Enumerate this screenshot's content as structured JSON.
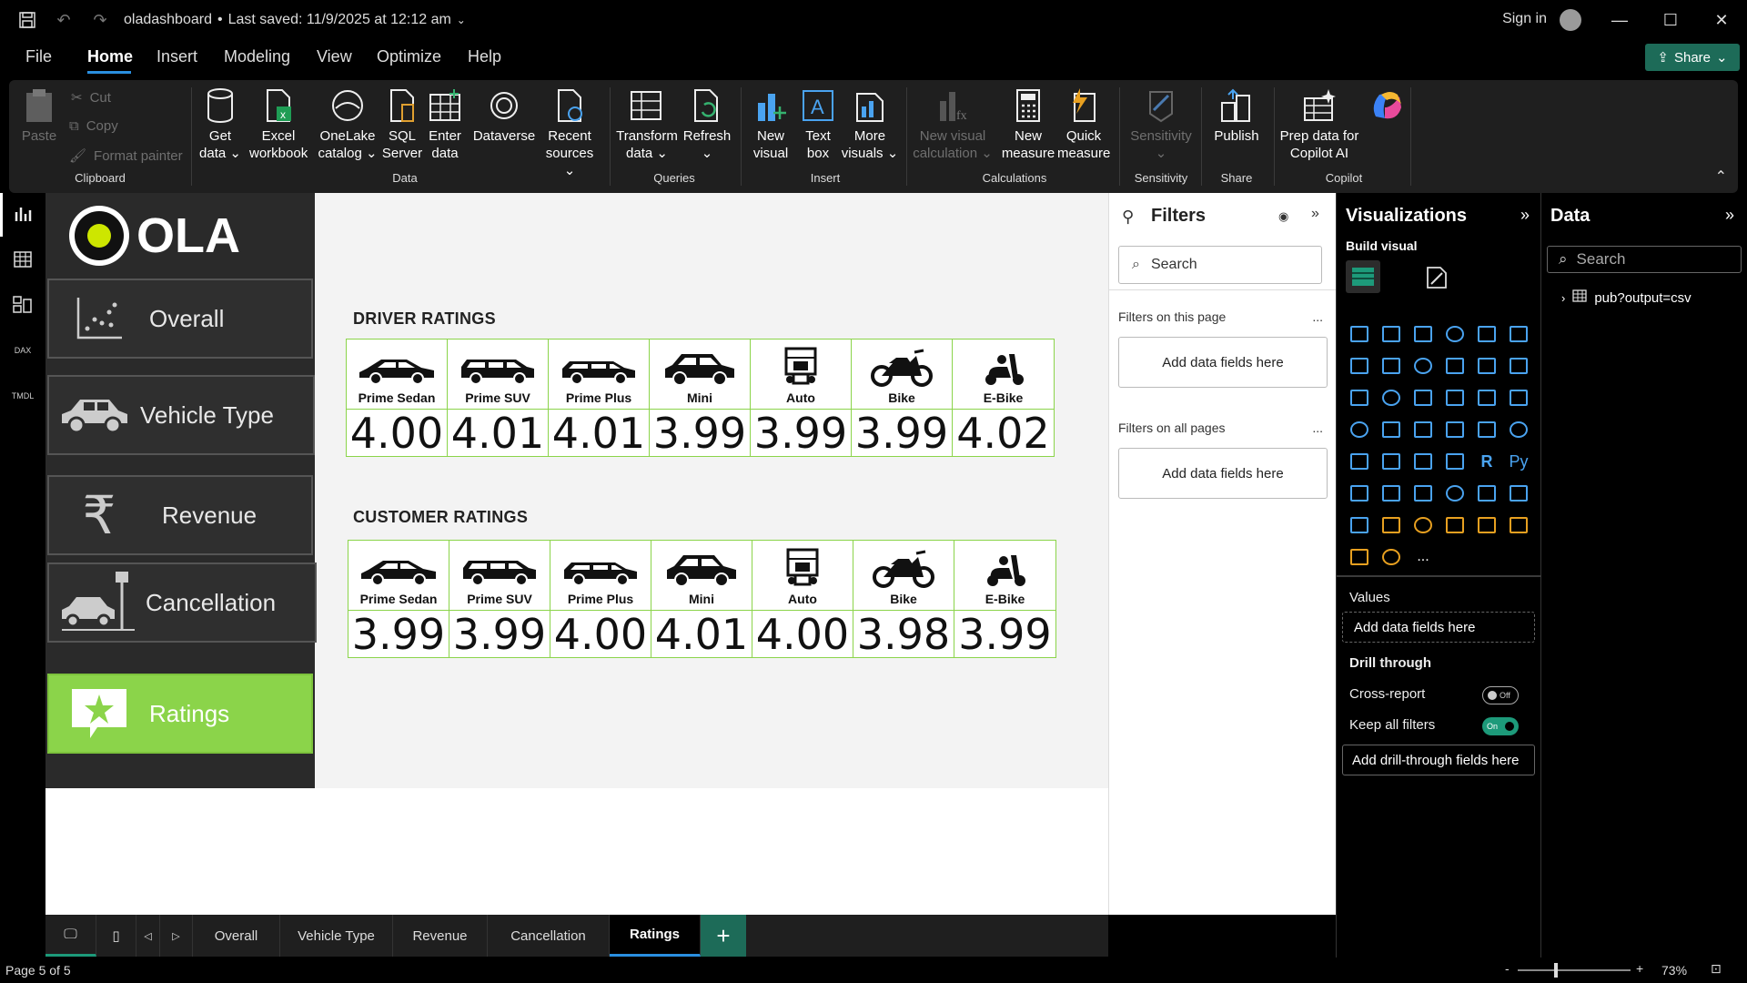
{
  "titlebar": {
    "title": "oladashboard",
    "saved": "Last saved: 11/9/2025 at 12:12 am",
    "signin": "Sign in"
  },
  "menu": [
    "File",
    "Home",
    "Insert",
    "Modeling",
    "View",
    "Optimize",
    "Help"
  ],
  "share_label": "Share",
  "ribbon": {
    "clipboard": {
      "paste": "Paste",
      "cut": "Cut",
      "copy": "Copy",
      "format_painter": "Format painter",
      "group": "Clipboard"
    },
    "data": {
      "get_data": "Get data ⌄",
      "excel": "Excel workbook",
      "onelake": "OneLake catalog ⌄",
      "sql": "SQL Server",
      "enter": "Enter data",
      "dataverse": "Dataverse",
      "recent": "Recent sources ⌄",
      "group": "Data"
    },
    "queries": {
      "transform": "Transform data ⌄",
      "refresh": "Refresh ⌄",
      "group": "Queries"
    },
    "insert": {
      "new_visual": "New visual",
      "text_box": "Text box",
      "more_visuals": "More visuals ⌄",
      "group": "Insert"
    },
    "calculations": {
      "new_visual_calc": "New visual calculation ⌄",
      "new_measure": "New measure",
      "quick_measure": "Quick measure",
      "group": "Calculations"
    },
    "sensitivity": {
      "label": "Sensitivity ⌄",
      "group": "Sensitivity"
    },
    "share": {
      "publish": "Publish",
      "group": "Share"
    },
    "copilot": {
      "prep": "Prep data for Copilot AI",
      "group": "Copilot"
    }
  },
  "report": {
    "logo_text": "OLA",
    "nav": [
      "Overall",
      "Vehicle Type",
      "Revenue",
      "Cancellation",
      "Ratings"
    ],
    "driver_title": "DRIVER RATINGS",
    "customer_title": "CUSTOMER RATINGS",
    "vehicle_types": [
      "Prime Sedan",
      "Prime SUV",
      "Prime Plus",
      "Mini",
      "Auto",
      "Bike",
      "E-Bike"
    ],
    "driver_ratings": [
      "4.00",
      "4.01",
      "4.01",
      "3.99",
      "3.99",
      "3.99",
      "4.02"
    ],
    "customer_ratings": [
      "3.99",
      "3.99",
      "4.00",
      "4.01",
      "4.00",
      "3.98",
      "3.99"
    ]
  },
  "filters": {
    "title": "Filters",
    "search_placeholder": "Search",
    "on_this_page": "Filters on this page",
    "on_all_pages": "Filters on all pages",
    "add_fields": "Add data fields here",
    "dots": "..."
  },
  "visualizations": {
    "title": "Visualizations",
    "build_visual": "Build visual",
    "values_label": "Values",
    "values_well": "Add data fields here",
    "drill_through": "Drill through",
    "cross_report": "Cross-report",
    "cross_report_state": "Off",
    "keep_all_filters": "Keep all filters",
    "keep_all_state": "On",
    "drill_well": "Add drill-through fields here",
    "r_label": "R",
    "py_label": "Py",
    "more": "..."
  },
  "data_pane": {
    "title": "Data",
    "search_placeholder": "Search",
    "table": "pub?output=csv"
  },
  "tabs": [
    "Overall",
    "Vehicle Type",
    "Revenue",
    "Cancellation",
    "Ratings"
  ],
  "status": {
    "page": "Page 5 of 5",
    "zoom": "73%"
  },
  "colors": {
    "accent_green": "#8bd44a",
    "share_teal": "#1d6b58",
    "tab_underline": "#2a8fe0"
  }
}
